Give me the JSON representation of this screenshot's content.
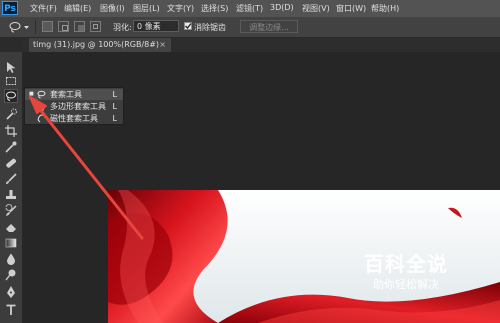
{
  "app": {
    "logo": "Ps"
  },
  "menus": [
    "文件(F)",
    "编辑(E)",
    "图像(I)",
    "图层(L)",
    "文字(Y)",
    "选择(S)",
    "滤镜(T)",
    "3D(D)",
    "视图(V)",
    "窗口(W)",
    "帮助(H)"
  ],
  "options": {
    "feather_label": "羽化:",
    "feather_value": "0 像素",
    "antialias_label": "消除锯齿",
    "refine_edge_label": "调整边缘..."
  },
  "document": {
    "tab_title": "timg (31).jpg @ 100%(RGB/8#)",
    "close_glyph": "×"
  },
  "lasso_flyout": {
    "items": [
      {
        "label": "套索工具",
        "shortcut": "L",
        "bullet": "■",
        "icon": "lasso-icon"
      },
      {
        "label": "多边形套索工具",
        "shortcut": "L",
        "bullet": "",
        "icon": "polygonal-lasso-icon"
      },
      {
        "label": "磁性套索工具",
        "shortcut": "L",
        "bullet": "",
        "icon": "magnetic-lasso-icon"
      }
    ]
  },
  "watermark": {
    "title": "百科全说",
    "subtitle": "助你轻松解决"
  },
  "colors": {
    "accent": "#31a8ff",
    "arrow": "#e8453c",
    "ribbon": "#c8141c"
  }
}
